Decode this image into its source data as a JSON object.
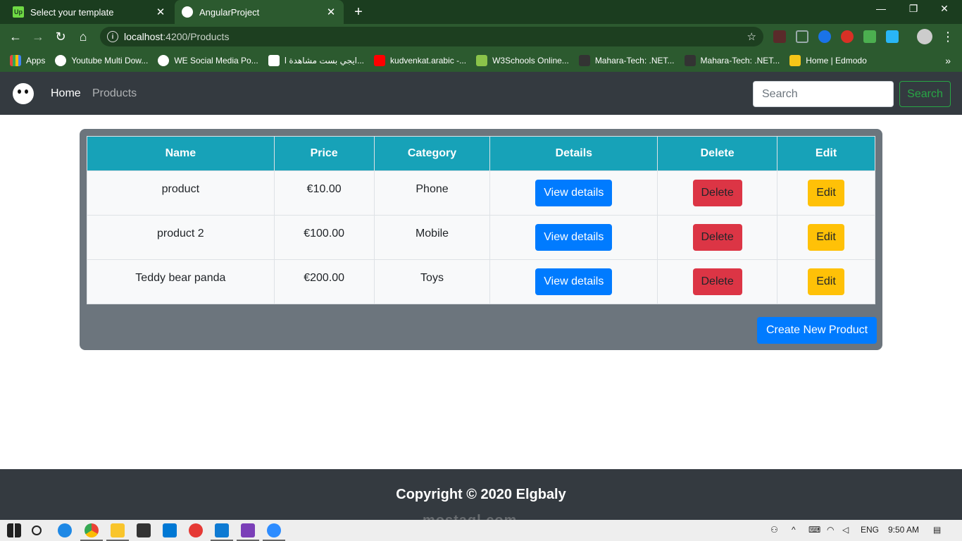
{
  "browser": {
    "tabs": [
      {
        "favicon_text": "Up",
        "title": "Select your template",
        "active": false
      },
      {
        "favicon_text": "",
        "title": "AngularProject",
        "active": true
      }
    ],
    "new_tab": "+",
    "url_host": "localhost",
    "url_path": ":4200/Products",
    "bookmarks": [
      {
        "label": "Apps",
        "icon": "apps-grid-icon"
      },
      {
        "label": "Youtube Multi Dow...",
        "icon": "globe-icon"
      },
      {
        "label": "WE Social Media Po...",
        "icon": "globe-icon"
      },
      {
        "label": "ايجي بست مشاهدة ا...",
        "icon": "egybest-icon"
      },
      {
        "label": "kudvenkat.arabic -...",
        "icon": "youtube-icon"
      },
      {
        "label": "W3Schools Online...",
        "icon": "w3schools-icon"
      },
      {
        "label": "Mahara-Tech: .NET...",
        "icon": "mahara-icon"
      },
      {
        "label": "Mahara-Tech: .NET...",
        "icon": "mahara-icon"
      },
      {
        "label": "Home | Edmodo",
        "icon": "edmodo-icon"
      }
    ],
    "bookmarks_more": "»"
  },
  "navbar": {
    "brand_icon": "panda-logo-icon",
    "links": [
      "Home",
      "Products"
    ],
    "search_placeholder": "Search",
    "search_button": "Search"
  },
  "table": {
    "headers": [
      "Name",
      "Price",
      "Category",
      "Details",
      "Delete",
      "Edit"
    ],
    "rows": [
      {
        "name": "product",
        "price": "€10.00",
        "category": "Phone",
        "details": "View details",
        "delete": "Delete",
        "edit": "Edit"
      },
      {
        "name": "product 2",
        "price": "€100.00",
        "category": "Mobile",
        "details": "View details",
        "delete": "Delete",
        "edit": "Edit"
      },
      {
        "name": "Teddy bear panda",
        "price": "€200.00",
        "category": "Toys",
        "details": "View details",
        "delete": "Delete",
        "edit": "Edit"
      }
    ],
    "create_button": "Create New Product"
  },
  "footer": {
    "copyright": "Copyright © 2020 Elgbaly",
    "watermark": "mostaql.com"
  },
  "taskbar": {
    "language": "ENG",
    "time": "9:50 AM"
  },
  "colors": {
    "navbar_bg": "#343a40",
    "header_bg": "#17a2b8",
    "card_bg": "#6c757d",
    "primary": "#007bff",
    "danger": "#dc3545",
    "warning": "#ffc107",
    "success": "#28a745"
  }
}
